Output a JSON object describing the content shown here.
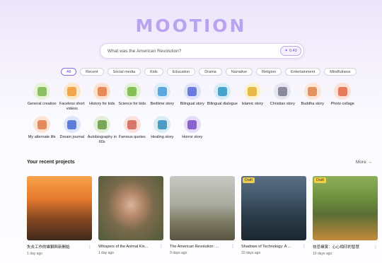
{
  "logo": "MOOTION",
  "search": {
    "placeholder": "What was the American Revolution?",
    "credits": "0.40"
  },
  "categories": [
    "All",
    "Recent",
    "Social media",
    "Kids",
    "Education",
    "Drama",
    "Narrative",
    "Religion",
    "Entertainment",
    "Mindfulness"
  ],
  "active_category": "All",
  "tools": [
    {
      "label": "General creation",
      "icon": "lightbulb-icon",
      "bg": "#e5f3d6",
      "fg": "#8cc063"
    },
    {
      "label": "Faceless short videos",
      "icon": "video-icon",
      "bg": "#fde7c9",
      "fg": "#f1a64a"
    },
    {
      "label": "History for kids",
      "icon": "temple-icon",
      "bg": "#fde1cf",
      "fg": "#e8895a"
    },
    {
      "label": "Science for kids",
      "icon": "flask-icon",
      "bg": "#e1f2d6",
      "fg": "#86be58"
    },
    {
      "label": "Bedtime story",
      "icon": "book-icon",
      "bg": "#dbeefa",
      "fg": "#5aa8dd"
    },
    {
      "label": "Bilingual story",
      "icon": "translate-icon",
      "bg": "#e0e4fb",
      "fg": "#6b7be0"
    },
    {
      "label": "Bilingual dialogue",
      "icon": "chat-icon",
      "bg": "#d8eef7",
      "fg": "#4aa3cc"
    },
    {
      "label": "Islamic story",
      "icon": "mosque-icon",
      "bg": "#fdf1cf",
      "fg": "#e7b947"
    },
    {
      "label": "Christian story",
      "icon": "cross-icon",
      "bg": "#e6e6ee",
      "fg": "#8a8a9e"
    },
    {
      "label": "Buddha story",
      "icon": "lotus-icon",
      "bg": "#fde6d8",
      "fg": "#e2935f"
    },
    {
      "label": "Photo collage",
      "icon": "photo-icon",
      "bg": "#fde0d6",
      "fg": "#e57a5c"
    },
    {
      "label": "My alternate life",
      "icon": "person-icon",
      "bg": "#fde4d4",
      "fg": "#e58a5d"
    },
    {
      "label": "Dream journal",
      "icon": "pen-icon",
      "bg": "#dde6fb",
      "fg": "#5b7fd8"
    },
    {
      "label": "Autobiography in 60s",
      "icon": "portrait-icon",
      "bg": "#e2efd9",
      "fg": "#7aa65a"
    },
    {
      "label": "Famous quotes",
      "icon": "quote-icon",
      "bg": "#fbe0dc",
      "fg": "#d9766a"
    },
    {
      "label": "Healing story",
      "icon": "heart-icon",
      "bg": "#d9ecf6",
      "fg": "#4d9cc6"
    },
    {
      "label": "Horror story",
      "icon": "ghost-icon",
      "bg": "#e6dcf7",
      "fg": "#8a62d0"
    }
  ],
  "recent": {
    "title": "Your recent projects",
    "more": "More →",
    "projects": [
      {
        "title": "失去工作的雄獅與新開始",
        "date": "1 day ago",
        "draft": "",
        "bg": "linear-gradient(180deg,#f7a24a 0%,#e77b2f 35%,#8a4a22 65%,#3f2a1c 100%)"
      },
      {
        "title": "Whispers of the Animal Kin...",
        "date": "1 day ago",
        "draft": "",
        "bg": "radial-gradient(ellipse at 50% 45%,#d9b59a 0%,#b38668 25%,#7a6a4c 50%,#4f5a3a 100%)"
      },
      {
        "title": "The American Revolution: ...",
        "date": "9 days ago",
        "draft": "",
        "bg": "linear-gradient(180deg,#c7c9c2 0%,#a9aa9e 45%,#7d7b63 70%,#5a5543 100%)"
      },
      {
        "title": "Shadows of Technology: A ...",
        "date": "10 days ago",
        "draft": "Draft",
        "bg": "linear-gradient(180deg,#5b7083 0%,#3f5568 35%,#2a3a47 65%,#1c2730 100%)"
      },
      {
        "title": "祛忌禪寅：心心相印的智慧",
        "date": "10 days ago",
        "draft": "Draft",
        "bg": "linear-gradient(180deg,#8fb05a 0%,#6d8f3e 35%,#5b6e35 60%,#c28a3c 100%)"
      }
    ]
  }
}
